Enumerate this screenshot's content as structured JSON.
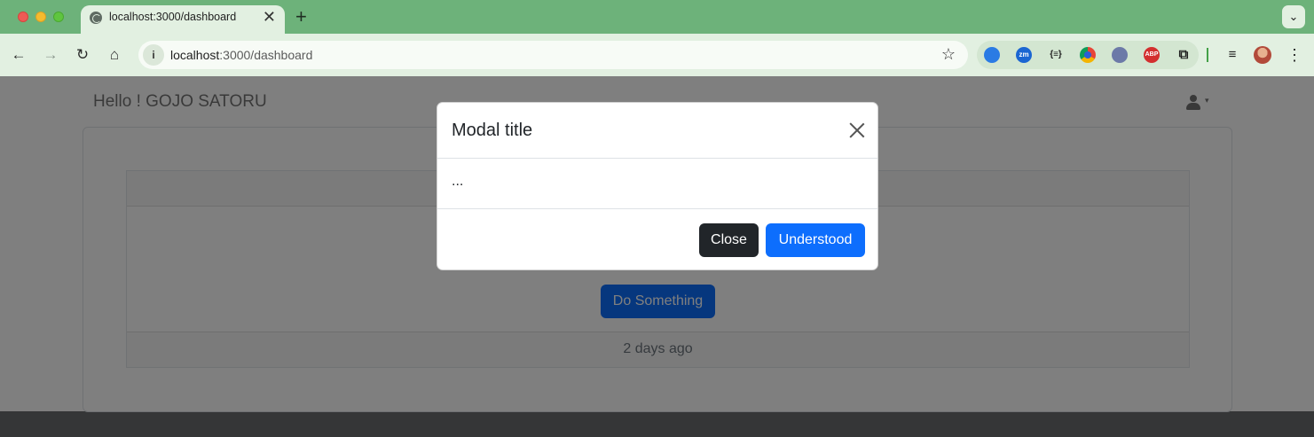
{
  "browser": {
    "tab_title": "localhost:3000/dashboard",
    "tab_close": "✕",
    "new_tab": "+",
    "tab_menu": "⌄",
    "url_host": "localhost",
    "url_path": ":3000/dashboard",
    "nav": {
      "back": "←",
      "forward": "→",
      "reload": "↻",
      "home": "⌂"
    },
    "site_info": "i",
    "bookmark": "☆",
    "extensions": [
      {
        "name": "extension-icon",
        "glyph": ""
      },
      {
        "name": "zoom-extension-icon",
        "glyph": "zm"
      },
      {
        "name": "json-extension-icon",
        "glyph": "{≡}"
      },
      {
        "name": "color-extension-icon",
        "glyph": ""
      },
      {
        "name": "extension-icon",
        "glyph": ""
      },
      {
        "name": "adblock-plus-icon",
        "glyph": "ABP"
      },
      {
        "name": "extensions-puzzle-icon",
        "glyph": "⧉"
      }
    ],
    "media": "≡",
    "menu": "⋮"
  },
  "page": {
    "brand": "Hello ! GOJO SATORU",
    "user_caret": "▾",
    "do_button": "Do Something",
    "footer_text": "2 days ago"
  },
  "modal": {
    "title": "Modal title",
    "body": "...",
    "close_label": "Close",
    "understood_label": "Understood"
  }
}
